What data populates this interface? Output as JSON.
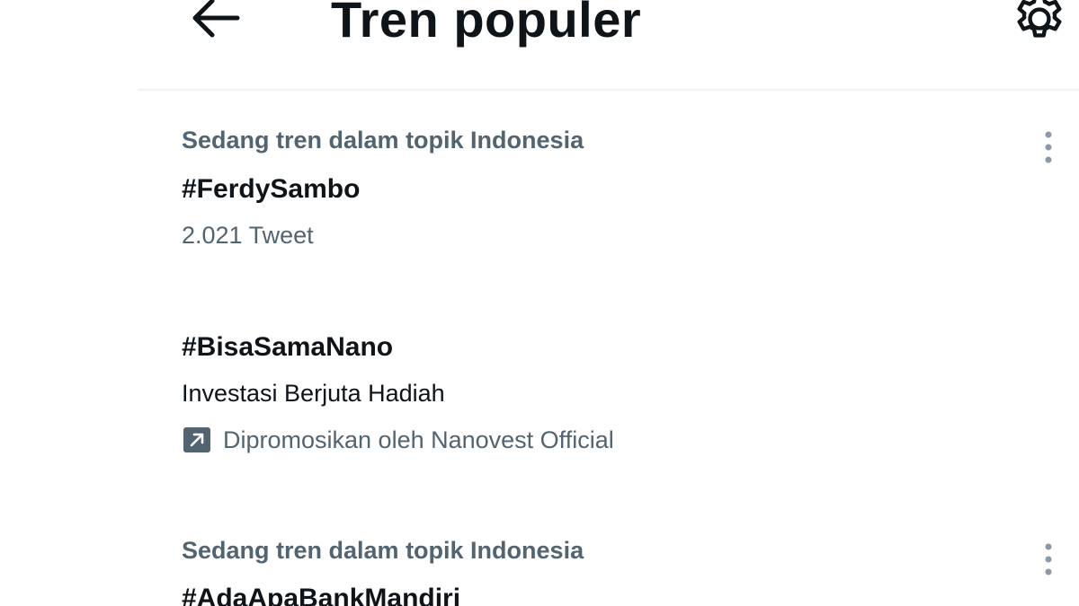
{
  "header": {
    "title": "Tren populer",
    "back_icon": "arrow-left-icon",
    "settings_icon": "gear-icon"
  },
  "trends": [
    {
      "context": "Sedang tren dalam topik Indonesia",
      "name": "#FerdySambo",
      "count": "2.021 Tweet"
    },
    {
      "name": "#BisaSamaNano",
      "description": "Investasi Berjuta Hadiah",
      "promoted": "Dipromosikan oleh Nanovest Official",
      "promoted_icon": "promoted-arrow-icon"
    },
    {
      "context": "Sedang tren dalam topik Indonesia",
      "name": "#AdaApaBankMandiri"
    }
  ],
  "colors": {
    "text_primary": "#0f1419",
    "text_secondary": "#536471",
    "divider": "#eff3f4"
  }
}
